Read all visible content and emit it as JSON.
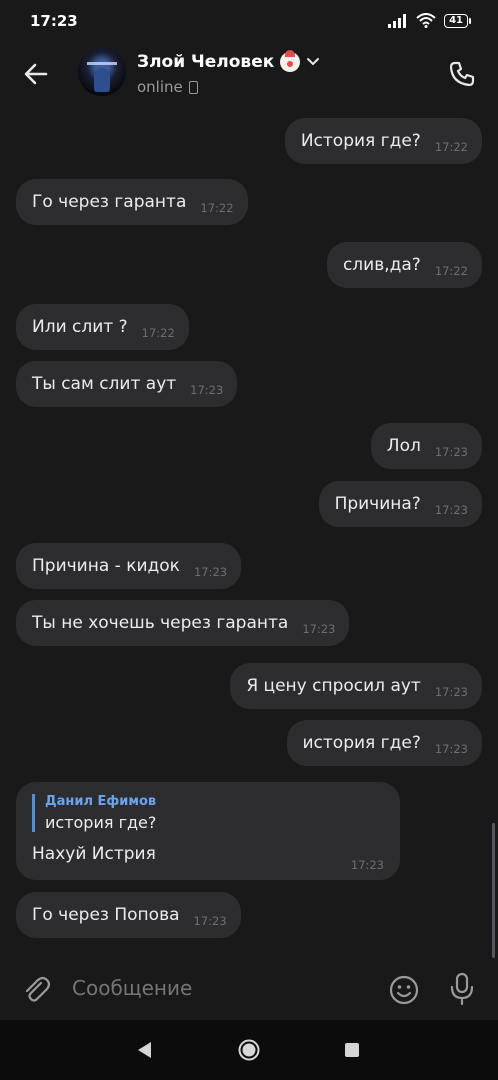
{
  "status_bar": {
    "time": "17:23",
    "battery": "41"
  },
  "header": {
    "title": "Злой Человек",
    "status": "online"
  },
  "messages": [
    {
      "text": "История где?",
      "time": "17:22",
      "side": "out"
    },
    {
      "text": "Го через гаранта",
      "time": "17:22",
      "side": "in"
    },
    {
      "text": "слив,да?",
      "time": "17:22",
      "side": "out"
    },
    {
      "text": "Или слит ?",
      "time": "17:22",
      "side": "in"
    },
    {
      "text": "Ты сам слит аут",
      "time": "17:23",
      "side": "in"
    },
    {
      "text": "Лол",
      "time": "17:23",
      "side": "out"
    },
    {
      "text": "Причина?",
      "time": "17:23",
      "side": "out"
    },
    {
      "text": "Причина - кидок",
      "time": "17:23",
      "side": "in"
    },
    {
      "text": "Ты не хочешь через гаранта",
      "time": "17:23",
      "side": "in"
    },
    {
      "text": "Я цену спросил аут",
      "time": "17:23",
      "side": "out"
    },
    {
      "text": "история где?",
      "time": "17:23",
      "side": "out"
    },
    {
      "reply_to_name": "Данил Ефимов",
      "reply_to_text": "история где?",
      "text": "Нахуй Истрия",
      "time": "17:23",
      "side": "in"
    },
    {
      "text": "Го через Попова",
      "time": "17:23",
      "side": "in"
    }
  ],
  "composer": {
    "placeholder": "Сообщение"
  },
  "icons": {
    "back": "arrow-left-icon",
    "call": "phone-icon",
    "attach": "paperclip-icon",
    "emoji": "smiley-icon",
    "mic": "microphone-icon"
  },
  "colors": {
    "background": "#19191a",
    "bubble": "#2d2d30",
    "reply_accent": "#4d8fe0",
    "reply_name": "#6aa4ef"
  }
}
